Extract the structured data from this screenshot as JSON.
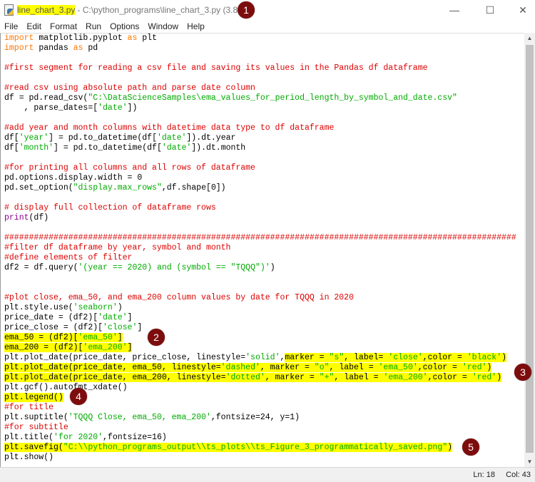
{
  "window": {
    "filename": "line_chart_3.py",
    "title_rest": "- C:\\python_programs\\line_chart_3.py (3.8.3)",
    "minimize": "—",
    "maximize": "☐",
    "close": "✕"
  },
  "menu": [
    "File",
    "Edit",
    "Format",
    "Run",
    "Options",
    "Window",
    "Help"
  ],
  "status": {
    "line": "Ln: 18",
    "col": "Col: 43"
  },
  "badges": [
    "1",
    "2",
    "3",
    "4",
    "5"
  ],
  "code": [
    [
      {
        "t": "import",
        "c": "k"
      },
      {
        "t": " matplotlib.pyplot ",
        "c": "n"
      },
      {
        "t": "as",
        "c": "k"
      },
      {
        "t": " plt",
        "c": "n"
      }
    ],
    [
      {
        "t": "import",
        "c": "k"
      },
      {
        "t": " pandas ",
        "c": "n"
      },
      {
        "t": "as",
        "c": "k"
      },
      {
        "t": " pd",
        "c": "n"
      }
    ],
    [],
    [
      {
        "t": "#first segment for reading a csv file and saving its values in the Pandas df dataframe",
        "c": "c"
      }
    ],
    [],
    [
      {
        "t": "#read csv using absolute path and parse date column",
        "c": "c"
      }
    ],
    [
      {
        "t": "df = pd.read_csv(",
        "c": "n"
      },
      {
        "t": "\"C:\\DataScienceSamples\\ema_values_for_period_length_by_symbol_and_date.csv\"",
        "c": "s"
      }
    ],
    [
      {
        "t": "    , parse_dates=[",
        "c": "n"
      },
      {
        "t": "'date'",
        "c": "s"
      },
      {
        "t": "])",
        "c": "n"
      }
    ],
    [],
    [
      {
        "t": "#add year and month columns with datetime data type to df dataframe",
        "c": "c"
      }
    ],
    [
      {
        "t": "df[",
        "c": "n"
      },
      {
        "t": "'year'",
        "c": "s"
      },
      {
        "t": "] = pd.to_datetime(df[",
        "c": "n"
      },
      {
        "t": "'date'",
        "c": "s"
      },
      {
        "t": "]).dt.year",
        "c": "n"
      }
    ],
    [
      {
        "t": "df[",
        "c": "n"
      },
      {
        "t": "'month'",
        "c": "s"
      },
      {
        "t": "] = pd.to_datetime(df[",
        "c": "n"
      },
      {
        "t": "'date'",
        "c": "s"
      },
      {
        "t": "]).dt.month",
        "c": "n"
      }
    ],
    [],
    [
      {
        "t": "#for printing all columns and all rows of dataframe",
        "c": "c"
      }
    ],
    [
      {
        "t": "pd.options.display.width = 0",
        "c": "n"
      }
    ],
    [
      {
        "t": "pd.set_option(",
        "c": "n"
      },
      {
        "t": "\"display.max_rows\"",
        "c": "s"
      },
      {
        "t": ",df.shape[0])",
        "c": "n"
      }
    ],
    [],
    [
      {
        "t": "# display full collection of dataframe rows",
        "c": "c"
      }
    ],
    [
      {
        "t": "print",
        "c": "b"
      },
      {
        "t": "(df)",
        "c": "n"
      }
    ],
    [],
    [
      {
        "t": "########################################################################################################",
        "c": "c"
      }
    ],
    [
      {
        "t": "#filter df dataframe by year, symbol and month",
        "c": "c"
      }
    ],
    [
      {
        "t": "#define elements of filter",
        "c": "c"
      }
    ],
    [
      {
        "t": "df2 = df.query(",
        "c": "n"
      },
      {
        "t": "'(year == 2020) and (symbol == \"TQQQ\")'",
        "c": "s"
      },
      {
        "t": ")",
        "c": "n"
      }
    ],
    [],
    [],
    [
      {
        "t": "#plot close, ema_50, and ema_200 column values by date for TQQQ in 2020",
        "c": "c"
      }
    ],
    [
      {
        "t": "plt.style.use(",
        "c": "n"
      },
      {
        "t": "'seaborn'",
        "c": "s"
      },
      {
        "t": ")",
        "c": "n"
      }
    ],
    [
      {
        "t": "price_date = (df2)[",
        "c": "n"
      },
      {
        "t": "'date'",
        "c": "s"
      },
      {
        "t": "]",
        "c": "n"
      }
    ],
    [
      {
        "t": "price_close = (df2)[",
        "c": "n"
      },
      {
        "t": "'close'",
        "c": "s"
      },
      {
        "t": "]",
        "c": "n"
      }
    ],
    [
      {
        "t": "ema_50 = (df2)[",
        "c": "n",
        "h": 1
      },
      {
        "t": "'ema_50'",
        "c": "s",
        "h": 1
      },
      {
        "t": "]",
        "c": "n",
        "h": 1
      }
    ],
    [
      {
        "t": "ema_200 = (df2)[",
        "c": "n",
        "h": 1
      },
      {
        "t": "'ema_200'",
        "c": "s",
        "h": 1
      },
      {
        "t": "]",
        "c": "n",
        "h": 1
      }
    ],
    [
      {
        "t": "plt.plot_date(price_date, price_close, linestyle=",
        "c": "n"
      },
      {
        "t": "'solid'",
        "c": "s"
      },
      {
        "t": ",",
        "c": "n"
      },
      {
        "t": "marker = ",
        "c": "n",
        "h": 1
      },
      {
        "t": "\"s\"",
        "c": "s",
        "h": 1
      },
      {
        "t": ", label= ",
        "c": "n",
        "h": 1
      },
      {
        "t": "'close'",
        "c": "s",
        "h": 1
      },
      {
        "t": ",color = ",
        "c": "n",
        "h": 1
      },
      {
        "t": "'black'",
        "c": "s",
        "h": 1
      },
      {
        "t": ")",
        "c": "n",
        "h": 1
      }
    ],
    [
      {
        "t": "plt.plot_date(price_date, ema_50, linestyle=",
        "c": "n",
        "h": 1
      },
      {
        "t": "'dashed'",
        "c": "s",
        "h": 1
      },
      {
        "t": ", marker = ",
        "c": "n",
        "h": 1
      },
      {
        "t": "\"o\"",
        "c": "s",
        "h": 1
      },
      {
        "t": ", label = ",
        "c": "n",
        "h": 1
      },
      {
        "t": "'ema_50'",
        "c": "s",
        "h": 1
      },
      {
        "t": ",color = ",
        "c": "n",
        "h": 1
      },
      {
        "t": "'red'",
        "c": "s",
        "h": 1
      },
      {
        "t": ")",
        "c": "n",
        "h": 1
      }
    ],
    [
      {
        "t": "plt.plot_date(price_date, ema_200, linestyle=",
        "c": "n",
        "h": 1
      },
      {
        "t": "'dotted'",
        "c": "s",
        "h": 1
      },
      {
        "t": ", marker = ",
        "c": "n",
        "h": 1
      },
      {
        "t": "\"+\"",
        "c": "s",
        "h": 1
      },
      {
        "t": ", label = ",
        "c": "n",
        "h": 1
      },
      {
        "t": "'ema_200'",
        "c": "s",
        "h": 1
      },
      {
        "t": ",color = ",
        "c": "n",
        "h": 1
      },
      {
        "t": "'red'",
        "c": "s",
        "h": 1
      },
      {
        "t": ")",
        "c": "n",
        "h": 1
      }
    ],
    [
      {
        "t": "plt.gcf().autofmt_xdate()",
        "c": "n"
      }
    ],
    [
      {
        "t": "plt.legend()",
        "c": "n",
        "h": 1
      }
    ],
    [
      {
        "t": "#for title",
        "c": "c"
      }
    ],
    [
      {
        "t": "plt.suptitle(",
        "c": "n"
      },
      {
        "t": "'TQQQ Close, ema_50, ema_200'",
        "c": "s"
      },
      {
        "t": ",fontsize=24, y=1)",
        "c": "n"
      }
    ],
    [
      {
        "t": "#for subtitle",
        "c": "c"
      }
    ],
    [
      {
        "t": "plt.title(",
        "c": "n"
      },
      {
        "t": "'for 2020'",
        "c": "s"
      },
      {
        "t": ",fontsize=16)",
        "c": "n"
      }
    ],
    [
      {
        "t": "plt.savefig(",
        "c": "n",
        "h": 1
      },
      {
        "t": "\"C:\\\\python_programs_output\\\\ts_plots\\\\ts_Figure_3_programmatically_saved.png\"",
        "c": "s",
        "h": 1
      },
      {
        "t": ")",
        "c": "n",
        "h": 1
      }
    ],
    [
      {
        "t": "plt.show()",
        "c": "n"
      }
    ]
  ]
}
